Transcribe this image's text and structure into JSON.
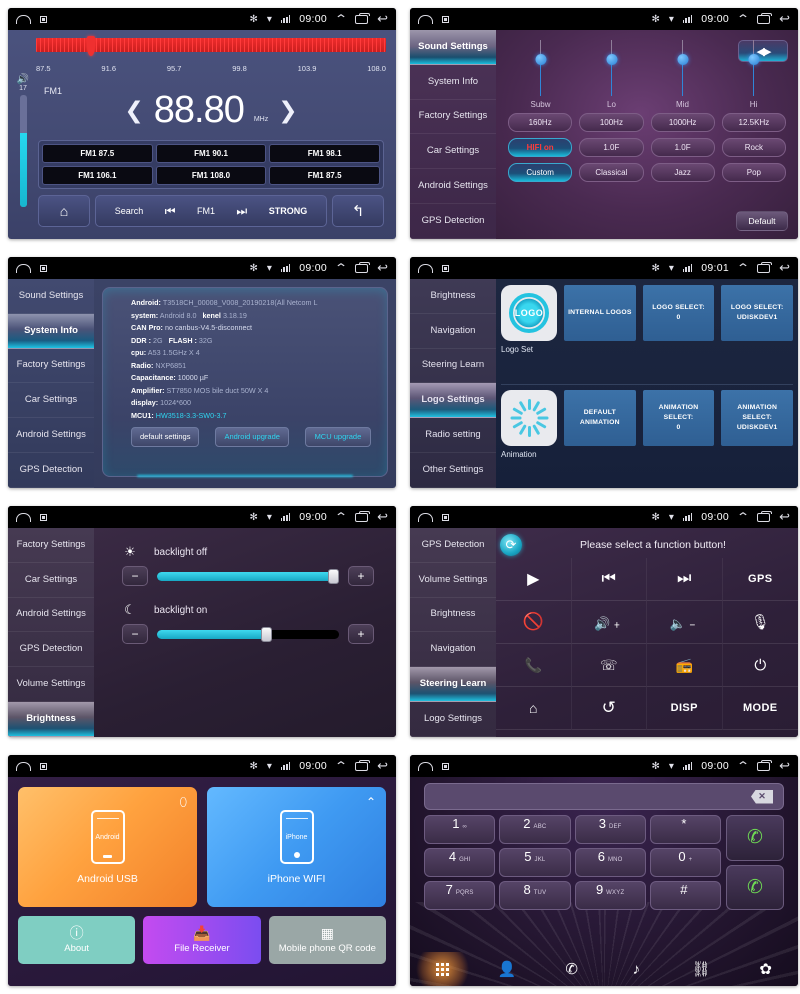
{
  "statusbar": {
    "home_icon": "home-outline-icon",
    "recents_icon": "square-icon",
    "bluetooth": "✻",
    "wifi": "wifi-icon",
    "signal": "signal-icon",
    "time": "09:00",
    "time_alt": "09:01",
    "expand_icon": "chevron-up-icon",
    "window_icon": "window-icon",
    "back_icon": "↩"
  },
  "radio": {
    "scale_labels": [
      "87.5",
      "91.6",
      "95.7",
      "99.8",
      "103.9",
      "108.0"
    ],
    "band_label": "FM1",
    "frequency": "88.80",
    "unit": "MHz",
    "prev_arrow": "❮",
    "next_arrow": "❯",
    "volume_value": "17",
    "volume_icon": "volume-icon",
    "presets": [
      "FM1 87.5",
      "FM1 90.1",
      "FM1 98.1",
      "FM1 106.1",
      "FM1 108.0",
      "FM1 87.5"
    ],
    "home_icon": "home-icon",
    "search_label": "Search",
    "prev_track": "⏮",
    "band_button": "FM1",
    "next_track": "⏭",
    "strong_label": "STRONG",
    "back_icon": "↰"
  },
  "sound": {
    "sidebar": [
      "Sound Settings",
      "System Info",
      "Factory Settings",
      "Car Settings",
      "Android Settings",
      "GPS Detection"
    ],
    "active": "Sound Settings",
    "balance_icon": "balance-speaker-icon",
    "sliders": [
      {
        "label": "Subw",
        "value": 75
      },
      {
        "label": "Lo",
        "value": 75
      },
      {
        "label": "Mid",
        "value": 75
      },
      {
        "label": "Hi",
        "value": 75
      }
    ],
    "row_freq": [
      "160Hz",
      "100Hz",
      "1000Hz",
      "12.5KHz"
    ],
    "row_mode": [
      "HIFI on",
      "1.0F",
      "1.0F",
      "Rock"
    ],
    "row_eq": [
      "Custom",
      "Classical",
      "Jazz",
      "Pop"
    ],
    "default_label": "Default",
    "accent": "#19b8d8"
  },
  "system": {
    "sidebar": [
      "Sound Settings",
      "System Info",
      "Factory Settings",
      "Car Settings",
      "Android Settings",
      "GPS Detection"
    ],
    "active": "System Info",
    "lines": [
      {
        "key": "Android:",
        "val": "T3518CH_00008_V008_20190218(All Netcom L",
        "style": "dim"
      },
      {
        "key": "system:",
        "val": "Android 8.0",
        "key2": "kenel",
        "val2": "3.18.19",
        "style": "dim"
      },
      {
        "key": "CAN Pro:",
        "val": "no canbus-V4.5-disconnect",
        "style": "bright"
      },
      {
        "key": "DDR :",
        "val": "2G",
        "key2": "FLASH :",
        "val2": "32G",
        "style": "dim"
      },
      {
        "key": "cpu:",
        "val": "A53 1.5GHz X 4",
        "style": "dim"
      },
      {
        "key": "Radio:",
        "val": "NXP6851",
        "style": "dim"
      },
      {
        "key": "Capacitance:",
        "val": "10000 µF",
        "style": "bright"
      },
      {
        "key": "Amplifier:",
        "val": "ST7850 MOS bile duct 50W X 4",
        "style": "dim"
      },
      {
        "key": "display:",
        "val": "1024*600",
        "style": "dim"
      },
      {
        "key": "MCU1:",
        "val": "HW3518-3.3-SW0-3.7",
        "style": "cyan"
      }
    ],
    "buttons": [
      "default settings",
      "Android upgrade",
      "MCU upgrade"
    ]
  },
  "logo": {
    "sidebar": [
      "Brightness",
      "Navigation",
      "Steering Learn",
      "Logo Settings",
      "Radio setting",
      "Other Settings"
    ],
    "active": "Logo Settings",
    "rows": [
      {
        "thumb_kind": "logo-circle",
        "thumb_text": "LOGO",
        "caption": "Logo Set",
        "buttons": [
          "INTERNAL LOGOS",
          "LOGO SELECT:\n0",
          "LOGO SELECT:\nUDISKDEV1"
        ]
      },
      {
        "thumb_kind": "spinner",
        "thumb_text": "",
        "caption": "Animation",
        "buttons": [
          "DEFAULT\nANIMATION",
          "ANIMATION\nSELECT:\n0",
          "ANIMATION\nSELECT:\nUDISKDEV1"
        ]
      }
    ]
  },
  "brightness": {
    "sidebar": [
      "Factory Settings",
      "Car Settings",
      "Android Settings",
      "GPS Detection",
      "Volume Settings",
      "Brightness"
    ],
    "active": "Brightness",
    "blocks": [
      {
        "icon": "sun-icon",
        "glyph": "☀",
        "title": "backlight off",
        "value": 100,
        "minus": "−",
        "plus": "+"
      },
      {
        "icon": "moon-icon",
        "glyph": "☾",
        "title": "backlight on",
        "value": 66,
        "minus": "−",
        "plus": "+"
      }
    ]
  },
  "steering": {
    "sidebar": [
      "GPS Detection",
      "Volume Settings",
      "Brightness",
      "Navigation",
      "Steering Learn",
      "Logo Settings"
    ],
    "active": "Steering Learn",
    "refresh_icon": "refresh-icon",
    "message": "Please select a function button!",
    "buttons": [
      {
        "name": "play-icon",
        "glyph": "▶",
        "type": "icon"
      },
      {
        "name": "previous-icon",
        "glyph": "⏮",
        "type": "icon"
      },
      {
        "name": "next-icon",
        "glyph": "⏭",
        "type": "icon"
      },
      {
        "name": "gps-button",
        "glyph": "GPS",
        "type": "text"
      },
      {
        "name": "mute-icon",
        "glyph": "⃠",
        "type": "icon"
      },
      {
        "name": "volume-up-icon",
        "glyph": "🔊+",
        "type": "icon"
      },
      {
        "name": "volume-down-icon",
        "glyph": "🔈−",
        "type": "icon"
      },
      {
        "name": "microphone-icon",
        "glyph": "🎤",
        "type": "icon"
      },
      {
        "name": "call-answer-icon",
        "glyph": "📞",
        "type": "icon"
      },
      {
        "name": "call-end-icon",
        "glyph": "☏",
        "type": "icon"
      },
      {
        "name": "radio-icon",
        "glyph": "📻",
        "type": "icon"
      },
      {
        "name": "power-icon",
        "glyph": "⏻",
        "type": "icon"
      },
      {
        "name": "home-icon",
        "glyph": "🏠",
        "type": "icon"
      },
      {
        "name": "back-icon",
        "glyph": "↺",
        "type": "icon"
      },
      {
        "name": "disp-button",
        "glyph": "DISP",
        "type": "text"
      },
      {
        "name": "mode-button",
        "glyph": "MODE",
        "type": "text"
      }
    ]
  },
  "link": {
    "cards": [
      {
        "name": "android-usb",
        "phone_label": "Android",
        "caption": "Android USB",
        "badge": "usb-icon",
        "badge_glyph": "⏻"
      },
      {
        "name": "iphone-wifi",
        "phone_label": "iPhone",
        "caption": "iPhone WIFI",
        "badge": "wifi-icon",
        "badge_glyph": "📶"
      }
    ],
    "bottom": [
      {
        "name": "about-button",
        "label": "About",
        "icon": "info-icon",
        "glyph": "ⓘ"
      },
      {
        "name": "file-receiver-button",
        "label": "File Receiver",
        "icon": "download-inbox-icon",
        "glyph": "⤓"
      },
      {
        "name": "qr-code-button",
        "label": "Mobile phone QR code",
        "icon": "qr-code-icon",
        "glyph": "▦"
      }
    ]
  },
  "dialer": {
    "input_value": "",
    "input_placeholder": "",
    "delete_icon": "backspace-icon",
    "keys": [
      {
        "num": "1",
        "sub": "∞"
      },
      {
        "num": "2",
        "sub": "ABC"
      },
      {
        "num": "3",
        "sub": "DEF"
      },
      {
        "num": "*",
        "sub": ""
      },
      {
        "num": "4",
        "sub": "GHI"
      },
      {
        "num": "5",
        "sub": "JKL"
      },
      {
        "num": "6",
        "sub": "MNO"
      },
      {
        "num": "0",
        "sub": "+"
      },
      {
        "num": "7",
        "sub": "PQRS"
      },
      {
        "num": "8",
        "sub": "TUV"
      },
      {
        "num": "9",
        "sub": "WXYZ"
      },
      {
        "num": "#",
        "sub": ""
      }
    ],
    "call_button": "call-icon",
    "call_glyph": "📞",
    "hangup_button": "hangup-icon",
    "hangup_glyph": "📞",
    "tabs": [
      {
        "name": "tab-keypad",
        "glyph": "keypad",
        "active": true
      },
      {
        "name": "tab-contacts",
        "glyph": "👤",
        "active": false
      },
      {
        "name": "tab-call-history",
        "glyph": "📞",
        "active": false
      },
      {
        "name": "tab-music",
        "glyph": "♪",
        "active": false
      },
      {
        "name": "tab-link",
        "glyph": "🔗",
        "active": false
      },
      {
        "name": "tab-settings",
        "glyph": "✿",
        "active": false
      }
    ]
  }
}
